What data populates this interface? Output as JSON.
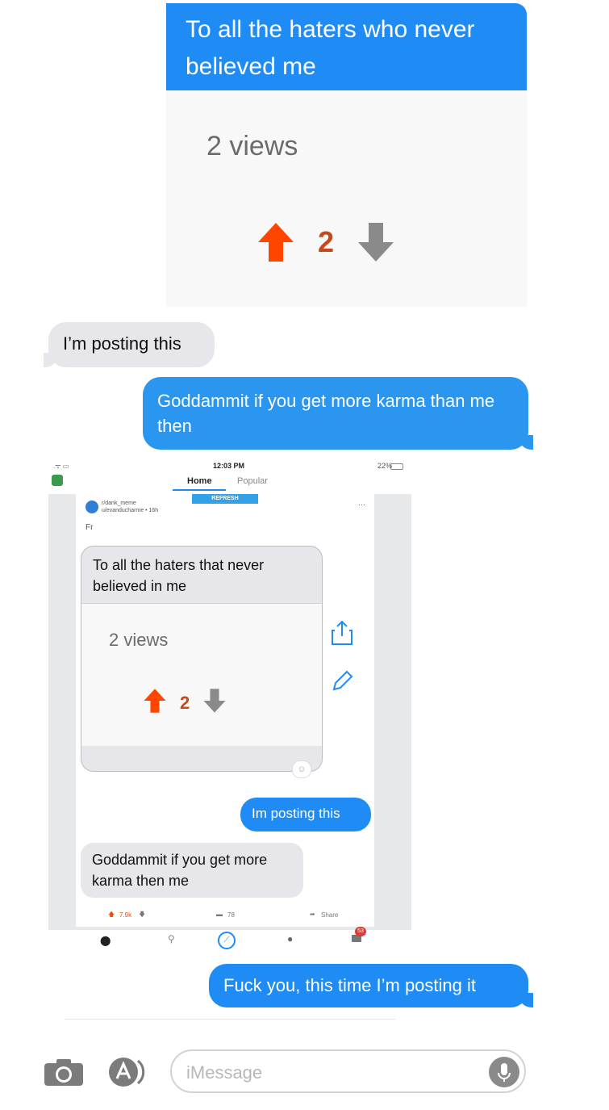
{
  "thread": {
    "msg1": "To all the haters who never believed me",
    "msg1_views": "2 views",
    "msg1_votes": "2",
    "msg2": "I’m posting this",
    "msg3": "Goddammit if you get more karma than me then",
    "msg4": "Fuck you, this time I’m posting it"
  },
  "screenshot": {
    "status_time": "12:03 PM",
    "status_battery": "22%",
    "tabs": [
      "Home",
      "Popular"
    ],
    "refresh_label": "REFRESH",
    "subreddit": "r/dank_meme",
    "user_line": "u/evanducharme • 16h",
    "post_title": "Fr",
    "inner_msg1": "To all the haters that never believed in me",
    "inner_views": "2 views",
    "inner_votes": "2",
    "inner_msg2": "Im posting this",
    "inner_msg3": "Goddammit if you get more karma then me",
    "score": "7.9k",
    "comments": "78",
    "share": "Share",
    "badge": "53"
  },
  "composer": {
    "placeholder": "iMessage"
  },
  "colors": {
    "imessage_blue": "#1f8bf5",
    "upvote": "#ff4500",
    "downvote": "#8a8a8a"
  }
}
